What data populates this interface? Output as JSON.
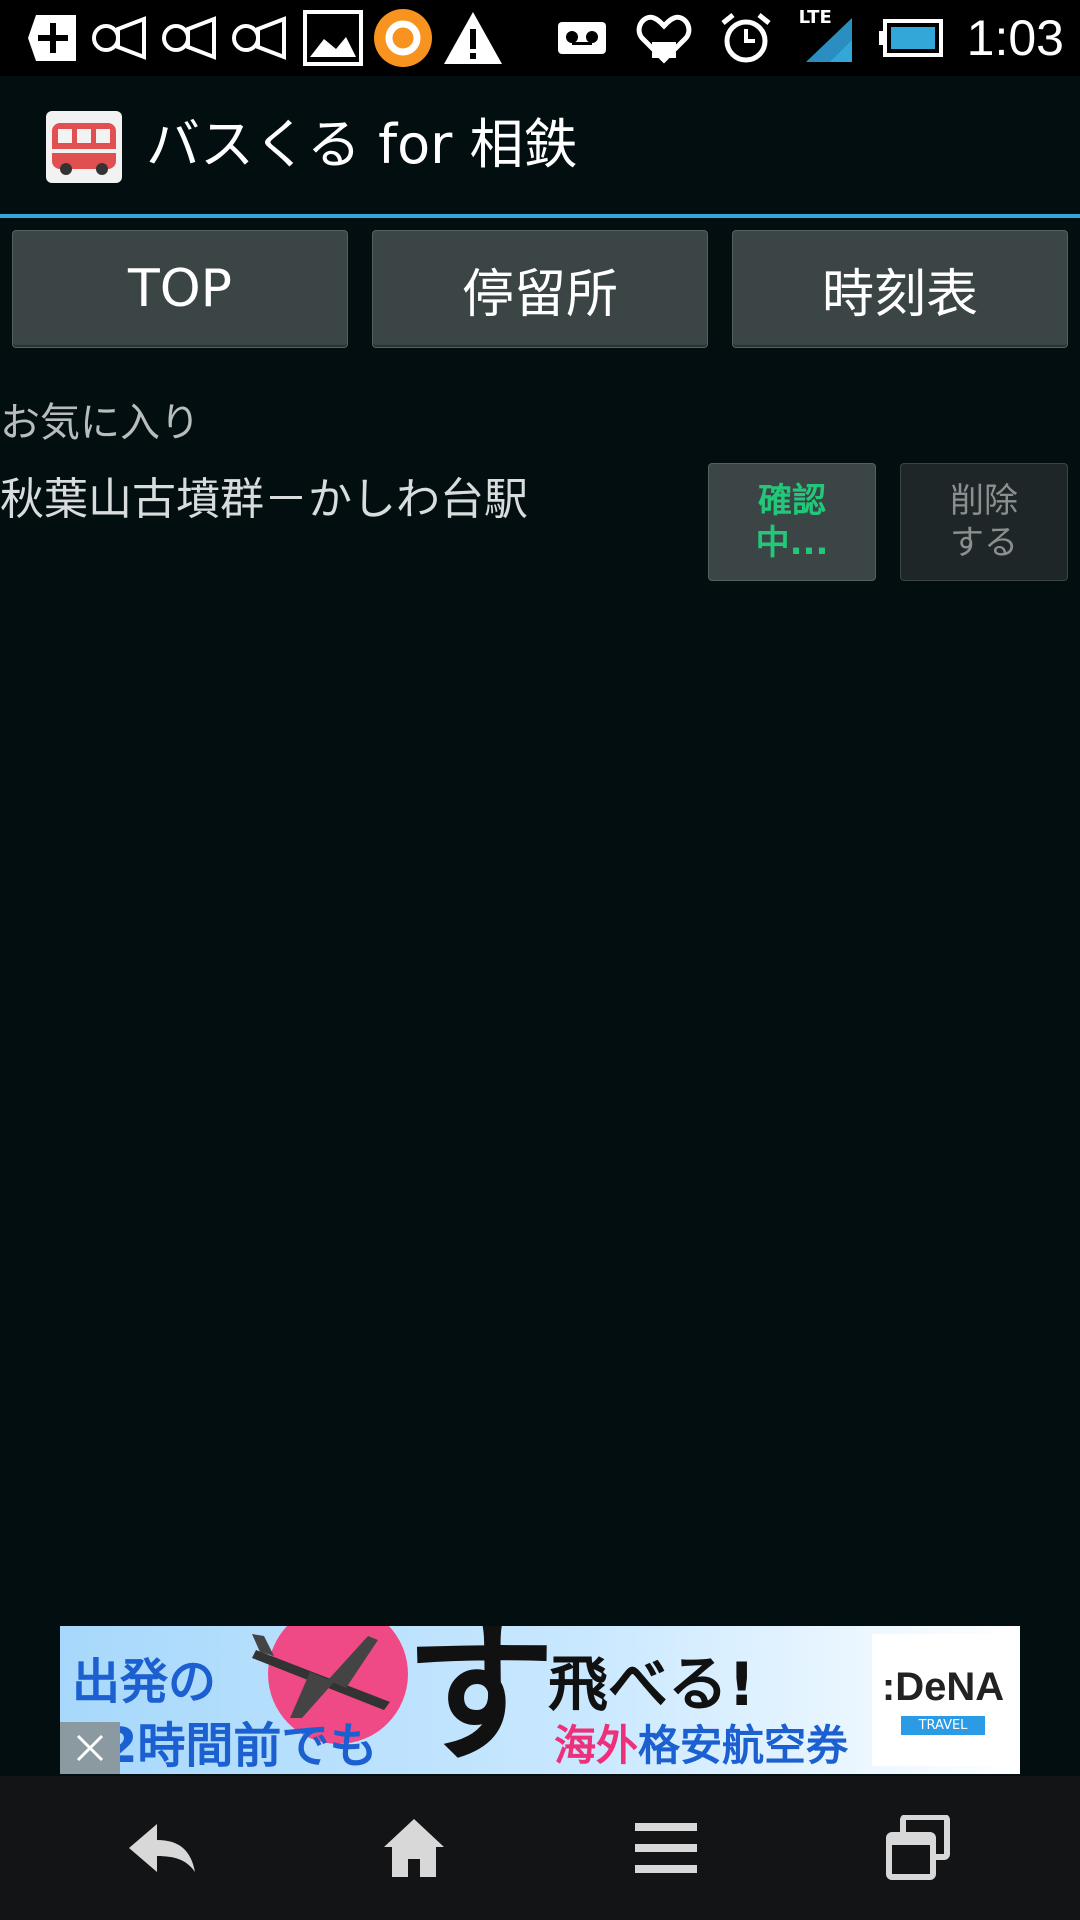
{
  "status_bar": {
    "time": "1:03",
    "network": "LTE",
    "left_icons": [
      "plus-icon",
      "megaphone-icon",
      "megaphone-icon",
      "megaphone-icon",
      "image-icon",
      "circle-app-icon",
      "warning-icon"
    ],
    "right_icons": [
      "voicemail-icon",
      "heart-icon",
      "alarm-icon",
      "signal-icon",
      "battery-icon"
    ]
  },
  "app": {
    "title": "バスくる for 相鉄",
    "accent_color": "#33a8d8"
  },
  "nav_tabs": [
    {
      "label": "TOP"
    },
    {
      "label": "停留所"
    },
    {
      "label": "時刻表"
    }
  ],
  "favorites": {
    "section_label": "お気に入り",
    "items": [
      {
        "name": "秋葉山古墳群－かしわ台駅",
        "check_label": "確認\n中...",
        "delete_label": "削除\nする"
      }
    ]
  },
  "ad": {
    "line1": "出発の",
    "line2": "2時間前でも",
    "big_char": "す",
    "headline": "飛べる!",
    "sub_pink": "海外",
    "sub_blue": "格安航空券",
    "brand": ":DeNA",
    "brand_sub": "TRAVEL"
  }
}
